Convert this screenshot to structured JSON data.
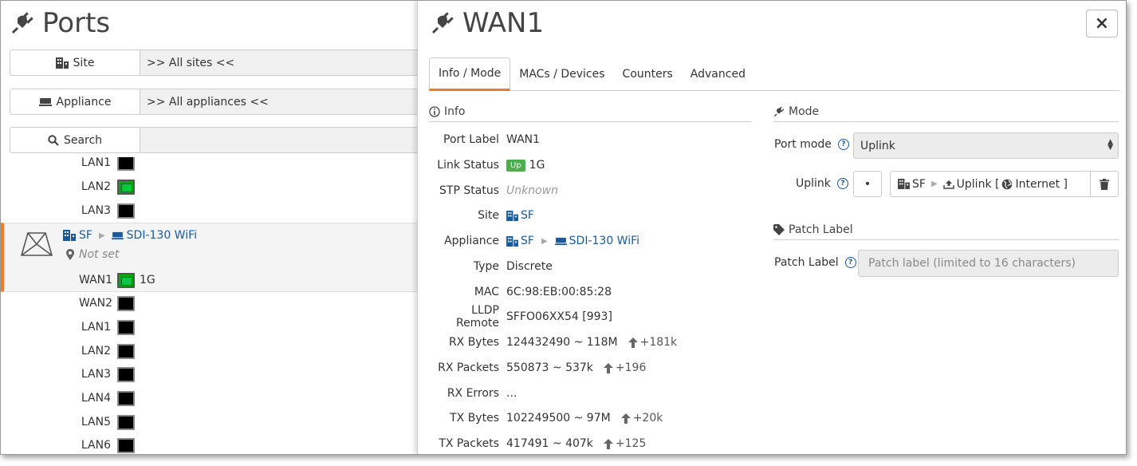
{
  "left": {
    "title": "Ports",
    "title_icon": "plug-icon",
    "filters": [
      {
        "label": "Site",
        "icon": "building-icon",
        "value": ">> All sites <<"
      },
      {
        "label": "Appliance",
        "icon": "appliance-icon",
        "value": ">> All appliances <<"
      },
      {
        "label": "Search",
        "icon": "search-icon",
        "value": ""
      }
    ],
    "ports_above": [
      {
        "name": "LAN1",
        "up": false
      },
      {
        "name": "LAN2",
        "up": true
      },
      {
        "name": "LAN3",
        "up": false
      }
    ],
    "appliance": {
      "site": "SF",
      "name": "SDI-130 WiFi",
      "location": "Not set"
    },
    "ports_below": [
      {
        "name": "WAN1",
        "up": true,
        "speed": "1G"
      },
      {
        "name": "WAN2",
        "up": false,
        "speed": ""
      },
      {
        "name": "LAN1",
        "up": false,
        "speed": ""
      },
      {
        "name": "LAN2",
        "up": false,
        "speed": ""
      },
      {
        "name": "LAN3",
        "up": false,
        "speed": ""
      },
      {
        "name": "LAN4",
        "up": false,
        "speed": ""
      },
      {
        "name": "LAN5",
        "up": false,
        "speed": ""
      },
      {
        "name": "LAN6",
        "up": false,
        "speed": ""
      }
    ]
  },
  "right": {
    "title": "WAN1",
    "close_label": "×",
    "tabs": [
      "Info / Mode",
      "MACs / Devices",
      "Counters",
      "Advanced"
    ],
    "active_tab": 0,
    "info_section": "Info",
    "info": {
      "port_label": {
        "label": "Port Label",
        "value": "WAN1"
      },
      "link_status": {
        "label": "Link Status",
        "badge": "Up",
        "value": "1G"
      },
      "stp_status": {
        "label": "STP Status",
        "value": "Unknown"
      },
      "site": {
        "label": "Site",
        "value": "SF"
      },
      "appliance": {
        "label": "Appliance",
        "site": "SF",
        "value": "SDI-130 WiFi"
      },
      "type": {
        "label": "Type",
        "value": "Discrete"
      },
      "mac": {
        "label": "MAC",
        "value": "6C:98:EB:00:85:28"
      },
      "lldp": {
        "label": "LLDP Remote",
        "value": "SFFO06XX54 [993]"
      },
      "rx_bytes": {
        "label": "RX Bytes",
        "value": "124432490 ~ 118M",
        "delta": "+181k"
      },
      "rx_packets": {
        "label": "RX Packets",
        "value": "550873 ~ 537k",
        "delta": "+196"
      },
      "rx_errors": {
        "label": "RX Errors",
        "value": "..."
      },
      "tx_bytes": {
        "label": "TX Bytes",
        "value": "102249500 ~ 97M",
        "delta": "+20k"
      },
      "tx_packets": {
        "label": "TX Packets",
        "value": "417491 ~ 407k",
        "delta": "+125"
      }
    },
    "mode_section": "Mode",
    "port_mode": {
      "label": "Port mode",
      "value": "Uplink"
    },
    "uplink": {
      "label": "Uplink",
      "dot": "•",
      "site": "SF",
      "name": "Uplink [",
      "network": "Internet ]"
    },
    "patch_section": "Patch Label",
    "patch": {
      "label": "Patch Label",
      "placeholder": "Patch label (limited to 16 characters)"
    }
  }
}
